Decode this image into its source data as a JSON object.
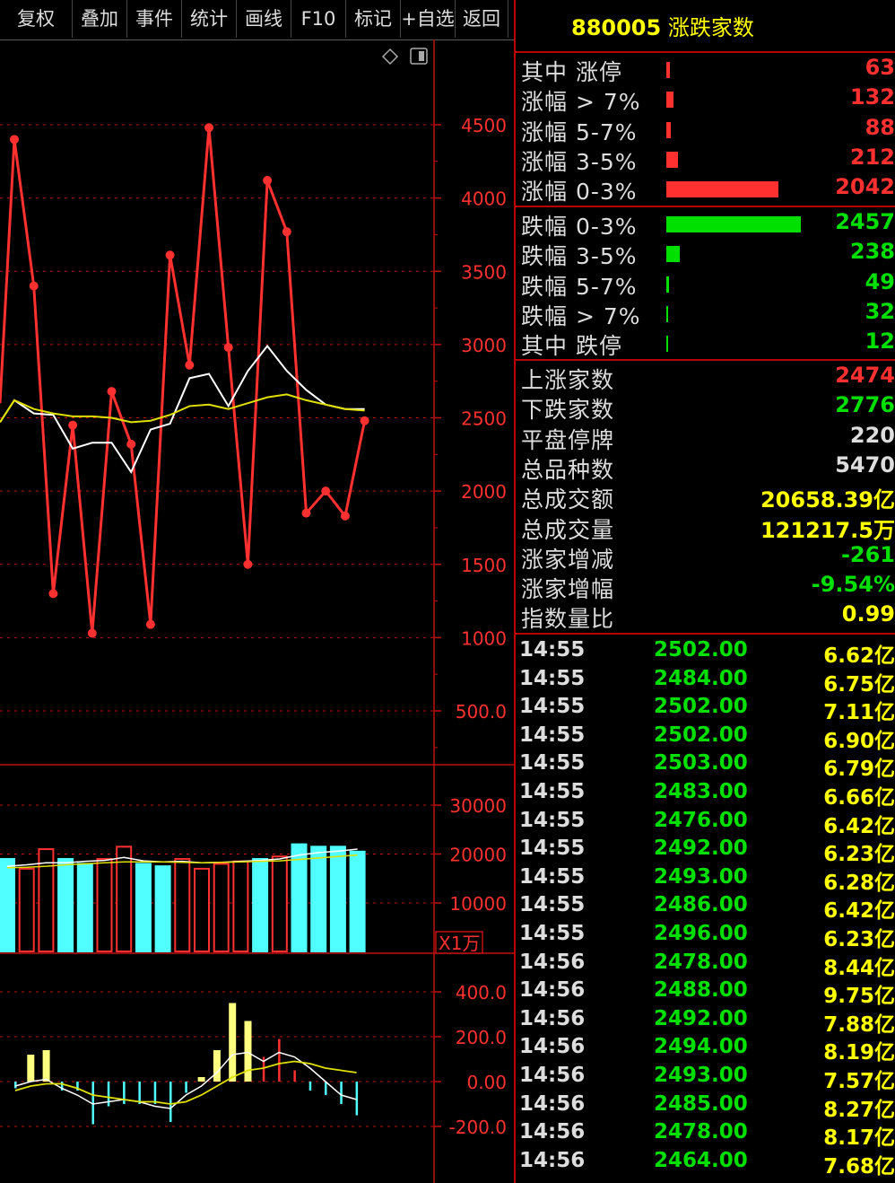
{
  "toolbar": {
    "buttons": [
      "复权",
      "叠加",
      "事件",
      "统计",
      "画线",
      "F10",
      "标记",
      "+自选",
      "返回"
    ]
  },
  "panel": {
    "code": "880005",
    "name": "涨跌家数"
  },
  "distribution": [
    {
      "label": "其中 涨停",
      "value": "63",
      "color": "#ff3030"
    },
    {
      "label": "涨幅 > 7%",
      "value": "132",
      "color": "#ff3030"
    },
    {
      "label": "涨幅 5-7%",
      "value": "88",
      "color": "#ff3030"
    },
    {
      "label": "涨幅 3-5%",
      "value": "212",
      "color": "#ff3030"
    },
    {
      "label": "涨幅 0-3%",
      "value": "2042",
      "color": "#ff3030"
    },
    {
      "label": "跌幅 0-3%",
      "value": "2457",
      "color": "#00e000"
    },
    {
      "label": "跌幅 3-5%",
      "value": "238",
      "color": "#00e000"
    },
    {
      "label": "跌幅 5-7%",
      "value": "49",
      "color": "#00e000"
    },
    {
      "label": "跌幅 > 7%",
      "value": "32",
      "color": "#00e000"
    },
    {
      "label": "其中 跌停",
      "value": "12",
      "color": "#00e000"
    }
  ],
  "summary": [
    {
      "label": "上涨家数",
      "value": "2474",
      "color": "#ff3030"
    },
    {
      "label": "下跌家数",
      "value": "2776",
      "color": "#00e000"
    },
    {
      "label": "平盘停牌",
      "value": "220",
      "color": "#dddddd"
    },
    {
      "label": "总品种数",
      "value": "5470",
      "color": "#dddddd"
    },
    {
      "label": "总成交额",
      "value": "20658.39亿",
      "color": "#ffff00"
    },
    {
      "label": "总成交量",
      "value": "121217.5万",
      "color": "#ffff00"
    },
    {
      "label": "涨家增减",
      "value": "-261",
      "color": "#00e000"
    },
    {
      "label": "涨家增幅",
      "value": "-9.54%",
      "color": "#00e000"
    },
    {
      "label": "指数量比",
      "value": "0.99",
      "color": "#ffff00"
    }
  ],
  "ticks": [
    {
      "time": "14:55",
      "price": "2502.00",
      "vol": "6.62亿"
    },
    {
      "time": "14:55",
      "price": "2484.00",
      "vol": "6.75亿"
    },
    {
      "time": "14:55",
      "price": "2502.00",
      "vol": "7.11亿"
    },
    {
      "time": "14:55",
      "price": "2502.00",
      "vol": "6.90亿"
    },
    {
      "time": "14:55",
      "price": "2503.00",
      "vol": "6.79亿"
    },
    {
      "time": "14:55",
      "price": "2483.00",
      "vol": "6.66亿"
    },
    {
      "time": "14:55",
      "price": "2476.00",
      "vol": "6.42亿"
    },
    {
      "time": "14:55",
      "price": "2492.00",
      "vol": "6.23亿"
    },
    {
      "time": "14:55",
      "price": "2493.00",
      "vol": "6.28亿"
    },
    {
      "time": "14:55",
      "price": "2486.00",
      "vol": "6.42亿"
    },
    {
      "time": "14:55",
      "price": "2496.00",
      "vol": "6.23亿"
    },
    {
      "time": "14:56",
      "price": "2478.00",
      "vol": "8.44亿"
    },
    {
      "time": "14:56",
      "price": "2488.00",
      "vol": "9.75亿"
    },
    {
      "time": "14:56",
      "price": "2492.00",
      "vol": "7.88亿"
    },
    {
      "time": "14:56",
      "price": "2494.00",
      "vol": "8.19亿"
    },
    {
      "time": "14:56",
      "price": "2493.00",
      "vol": "7.57亿"
    },
    {
      "time": "14:56",
      "price": "2485.00",
      "vol": "8.27亿"
    },
    {
      "time": "14:56",
      "price": "2478.00",
      "vol": "8.17亿"
    },
    {
      "time": "14:56",
      "price": "2464.00",
      "vol": "7.68亿"
    }
  ],
  "chart_data": [
    {
      "type": "line",
      "y_ticks": [
        "4500",
        "4000",
        "3500",
        "3000",
        "2500",
        "2000",
        "1500",
        "1000",
        "500.0"
      ],
      "ylim": [
        250,
        4900
      ],
      "series": [
        {
          "values": [
            4400,
            3400,
            1300,
            2450,
            1030,
            2680,
            2320,
            1090,
            3610,
            2860,
            4480,
            2980,
            1500,
            4120,
            3770,
            1850,
            2000,
            1830,
            2480
          ],
          "color": "#ff3030"
        },
        {
          "values": [
            2620,
            2530,
            2520,
            2290,
            2330,
            2330,
            2130,
            2420,
            2460,
            2770,
            2800,
            2580,
            2820,
            2990,
            2820,
            2690,
            2590,
            2560,
            2560
          ],
          "color": "#ffffff"
        },
        {
          "values": [
            2620,
            2560,
            2530,
            2510,
            2510,
            2500,
            2470,
            2480,
            2520,
            2580,
            2590,
            2560,
            2600,
            2640,
            2660,
            2620,
            2590,
            2560,
            2550
          ],
          "color": "#e0e000"
        }
      ]
    },
    {
      "type": "bar",
      "y_ticks": [
        "30000",
        "20000",
        "10000"
      ],
      "unit_label": "X1万",
      "ylim": [
        0,
        36000
      ],
      "values": [
        19000,
        17000,
        21000,
        19000,
        18000,
        19000,
        21500,
        18000,
        17500,
        19000,
        17000,
        18000,
        18500,
        19000,
        19500,
        22000,
        21500,
        21500,
        20500
      ],
      "up": [
        false,
        true,
        true,
        false,
        false,
        true,
        true,
        false,
        false,
        true,
        true,
        true,
        true,
        false,
        true,
        false,
        false,
        false,
        false
      ],
      "ma1": [
        17500,
        17800,
        18200,
        18200,
        18500,
        18700,
        19300,
        18600,
        18400,
        18500,
        18200,
        18300,
        18500,
        18700,
        19000,
        19800,
        20300,
        20600,
        21000
      ],
      "ma2": [
        17200,
        17300,
        17500,
        17800,
        18000,
        18200,
        18400,
        18400,
        18400,
        18300,
        18200,
        18300,
        18400,
        18500,
        18600,
        18900,
        19200,
        19500,
        19800
      ]
    },
    {
      "type": "bar",
      "y_ticks": [
        "400.0",
        "200.0",
        "0.00",
        "-200.0"
      ],
      "ylim": [
        -300,
        500
      ],
      "values": [
        -30,
        120,
        140,
        -40,
        -40,
        -190,
        -110,
        -100,
        -100,
        -100,
        -180,
        -50,
        20,
        140,
        350,
        270,
        110,
        190,
        50,
        -40,
        -60,
        -100,
        -150
      ],
      "color_hint": [
        "c",
        "y",
        "y",
        "c",
        "c",
        "c",
        "c",
        "c",
        "c",
        "c",
        "c",
        "c",
        "y",
        "y",
        "y",
        "y",
        "r",
        "r",
        "r",
        "c",
        "c",
        "c",
        "c"
      ],
      "line_white": [
        -20,
        0,
        10,
        -30,
        -60,
        -100,
        -90,
        -80,
        -90,
        -110,
        -120,
        -60,
        -20,
        40,
        120,
        130,
        90,
        130,
        110,
        60,
        0,
        -60,
        -80
      ],
      "line_yellow": [
        -40,
        -20,
        -10,
        -10,
        -30,
        -60,
        -70,
        -80,
        -90,
        -90,
        -100,
        -90,
        -60,
        -20,
        20,
        50,
        60,
        80,
        90,
        80,
        60,
        50,
        40
      ]
    }
  ]
}
